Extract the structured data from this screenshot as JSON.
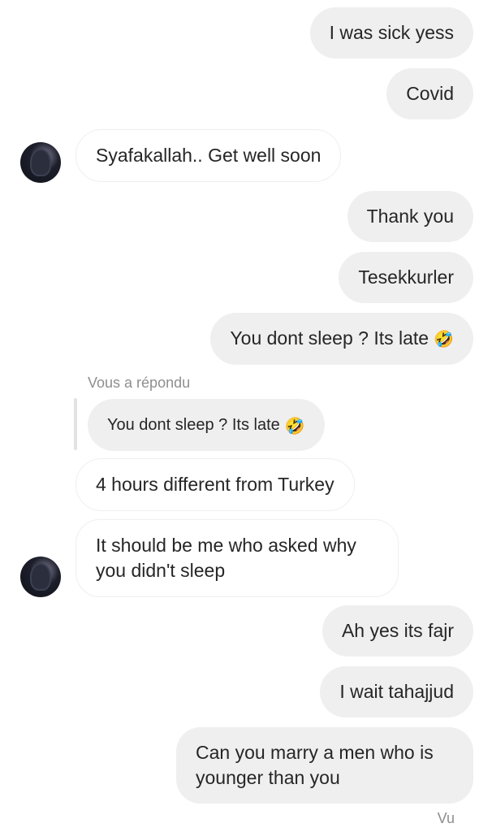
{
  "messages": {
    "m1": "I was sick yess",
    "m2": "Covid",
    "m3": "Syafakallah.. Get well soon",
    "m4": "Thank you",
    "m5": "Tesekkurler",
    "m6": "You dont sleep ? Its late",
    "m6_emoji": "🤣",
    "reply_label": "Vous a répondu",
    "quoted_text": "You dont sleep ? Its late",
    "quoted_emoji": "🤣",
    "m7": "4 hours different from Turkey",
    "m8": "It should be me who asked why you didn't sleep",
    "m9": "Ah yes its fajr",
    "m10": "I wait tahajjud",
    "m11": "Can you marry a men who is younger than you"
  },
  "status": {
    "seen": "Vu"
  },
  "colors": {
    "outgoing_bubble": "#efefef",
    "incoming_border": "#efefef",
    "meta_text": "#8e8e8e"
  }
}
